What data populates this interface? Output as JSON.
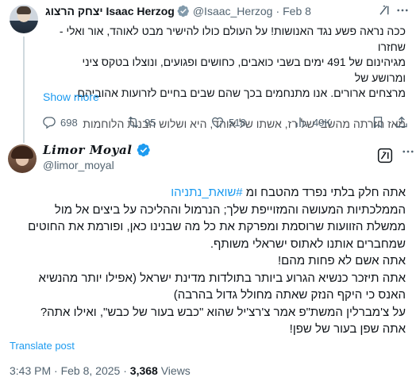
{
  "parent_tweet": {
    "author_name": "יצחק הרצוג Isaac Herzog",
    "handle": "@Isaac_Herzog",
    "separator": "·",
    "date": "Feb 8",
    "body_lines": [
      "ככה נראה פשע נגד האנושות! על העולם כולו להישיר מבט לאוהד, אור ואלי - שחזרו",
      "מגיהינום של 491 ימים בשבי כואבים, כחושים ופגועים, ונוצלו בטקס ציני ומרושע של",
      "מרצחים ארורים. אנו מתנחמים בכך שהם שבים בחיים לזרועות אהוביהם."
    ],
    "body_faded_line": "מאז חזרתה מהשבי של רז, אשתו של אוהד, היא ושלוש הבנות הלוחמות",
    "show_more": "Show more",
    "stats": {
      "replies": "698",
      "reposts": "95",
      "likes": "518",
      "views": "49K"
    }
  },
  "main_tweet": {
    "author_name": "Limor Moyal",
    "handle": "@limor_moyal",
    "line1_prefix": "אתה חלק בלתי נפרד מהטבח ומ ",
    "hashtag": "#שואת_נתניהו",
    "body_lines": [
      "הממלכתיות המעושה והמזוייפת שלך; הנרמול וההליכה על ביצים אל מול",
      "ממשלת הזוועות שרוסמת ומפרקת את כל מה שבנינו כאן, ופורמת את החוטים",
      "שמחברים אותנו לאתוס ישראלי משותף.",
      "אתה אשם לא פחות מהם!",
      "אתה תיזכר כנשיא הגרוע ביותר בתולדות מדינת ישראל (אפילו יותר מהנשיא",
      "האנס כי היקף הנזק שאתה מחולל גדול בהרבה)",
      "על צ'מברלין המשת\"פ אמר צ'רצ'יל שהוא \"כבש בעור של כבש\", ואילו אתה?",
      "אתה שפן בעור של שפן!"
    ],
    "translate": "Translate post",
    "time": "3:43 PM",
    "separator": "·",
    "date": "Feb 8, 2025",
    "views_count": "3,368",
    "views_label": "Views"
  },
  "icons": {
    "verified_grey": "grey-verified-badge-icon",
    "verified_blue": "blue-verified-badge-icon",
    "grok": "grok-icon",
    "more": "more-dots-icon",
    "reply": "reply-icon",
    "repost": "repost-icon",
    "like": "heart-icon",
    "views": "views-chart-icon",
    "bookmark": "bookmark-icon",
    "share": "share-icon"
  },
  "colors": {
    "link_blue": "#1d9bf0",
    "muted_text": "#536471",
    "verified_grey": "#829aab",
    "verified_blue": "#1d9bf0"
  }
}
